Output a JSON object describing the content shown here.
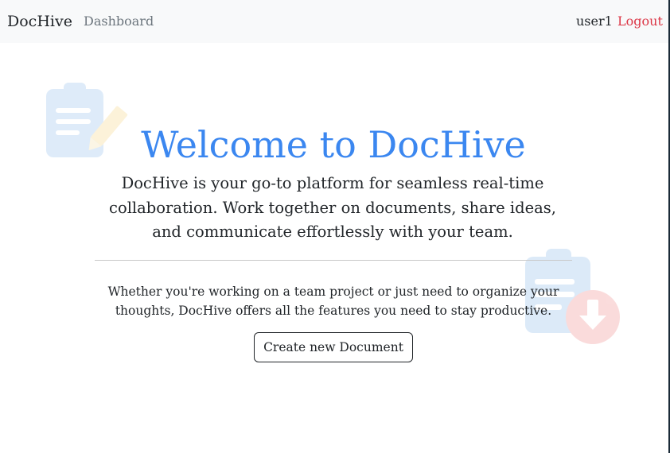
{
  "navbar": {
    "brand": "DocHive",
    "dashboard_label": "Dashboard",
    "username": "user1",
    "logout_label": "Logout"
  },
  "hero": {
    "title": "Welcome to DocHive",
    "lead": "DocHive is your go-to platform for seamless real-time collaboration. Work together on documents, share ideas, and communicate effortlessly with your team.",
    "sub": "Whether you're working on a team project or just need to organize your thoughts, DocHive offers all the features you need to stay productive.",
    "create_button_label": "Create new Document"
  },
  "icons": {
    "decor_left": "clipboard-edit-icon",
    "decor_right": "clipboard-download-icon"
  },
  "colors": {
    "navbar_bg": "#f8f9fa",
    "title": "#3b87f0",
    "logout": "#dc3545",
    "muted": "#6c757d"
  }
}
